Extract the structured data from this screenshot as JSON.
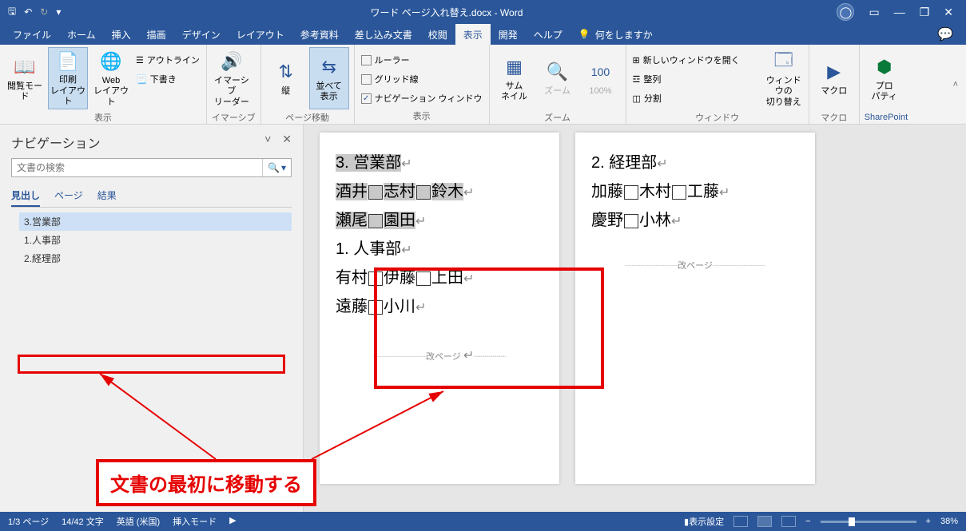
{
  "titlebar": {
    "title": "ワード ページ入れ替え.docx  -  Word"
  },
  "qat": {
    "save": "💾",
    "undo": "↶",
    "redo": "↻",
    "more": "⁝"
  },
  "win": {
    "min": "—",
    "restore": "❐",
    "close": "✕",
    "ribbon": "⬚"
  },
  "tabs": {
    "file": "ファイル",
    "home": "ホーム",
    "insert": "挿入",
    "draw": "描画",
    "design": "デザイン",
    "layout": "レイアウト",
    "references": "参考資料",
    "mailings": "差し込み文書",
    "review": "校閲",
    "view": "表示",
    "developer": "開発",
    "help": "ヘルプ",
    "tellme": "何をしますか"
  },
  "ribbon": {
    "views": {
      "read": "閲覧モード",
      "print": "印刷\nレイアウト",
      "web": "Web\nレイアウト",
      "outline": "アウトライン",
      "draft": "下書き",
      "group": "表示"
    },
    "immersive": {
      "reader": "イマーシブ\nリーダー",
      "group": "イマーシブ"
    },
    "pagemove": {
      "vertical": "縦",
      "sidebyside": "並べて\n表示",
      "group": "ページ移動"
    },
    "show": {
      "ruler": "ルーラー",
      "gridlines": "グリッド線",
      "navpane": "ナビゲーション ウィンドウ",
      "group": "表示"
    },
    "zoom": {
      "thumbnails": "サム\nネイル",
      "zoom": "ズーム",
      "hundred": "100%",
      "group": "ズーム"
    },
    "window": {
      "newwin": "新しいウィンドウを開く",
      "arrange": "整列",
      "split": "分割",
      "switch": "ウィンドウの\n切り替え",
      "group": "ウィンドウ"
    },
    "macro": {
      "label": "マクロ",
      "group": "マクロ"
    },
    "sharepoint": {
      "label": "プロ\nパティ",
      "group": "SharePoint"
    }
  },
  "nav": {
    "title": "ナビゲーション",
    "search_placeholder": "文書の検索",
    "tabs": {
      "headings": "見出し",
      "pages": "ページ",
      "results": "結果"
    },
    "items": [
      "3.営業部",
      "1.人事部",
      "2.経理部"
    ]
  },
  "callout": "文書の最初に移動する",
  "document": {
    "page1": {
      "sec1": {
        "title": "3. 営業部",
        "line1": [
          "酒井",
          "志村",
          "鈴木"
        ],
        "line2": [
          "瀬尾",
          "園田"
        ]
      },
      "sec2": {
        "title": "1. 人事部",
        "line1": [
          "有村",
          "伊藤",
          "上田"
        ],
        "line2": [
          "遠藤",
          "小川"
        ]
      },
      "page_break": "改ページ"
    },
    "page2": {
      "sec1": {
        "title": "2. 経理部",
        "line1": [
          "加藤",
          "木村",
          "工藤"
        ],
        "line2": [
          "慶野",
          "小林"
        ]
      },
      "page_break": "改ページ"
    }
  },
  "status": {
    "page": "1/3 ページ",
    "words": "14/42 文字",
    "lang": "英語 (米国)",
    "mode": "挿入モード",
    "display": "表示設定",
    "zoom": "38%"
  }
}
